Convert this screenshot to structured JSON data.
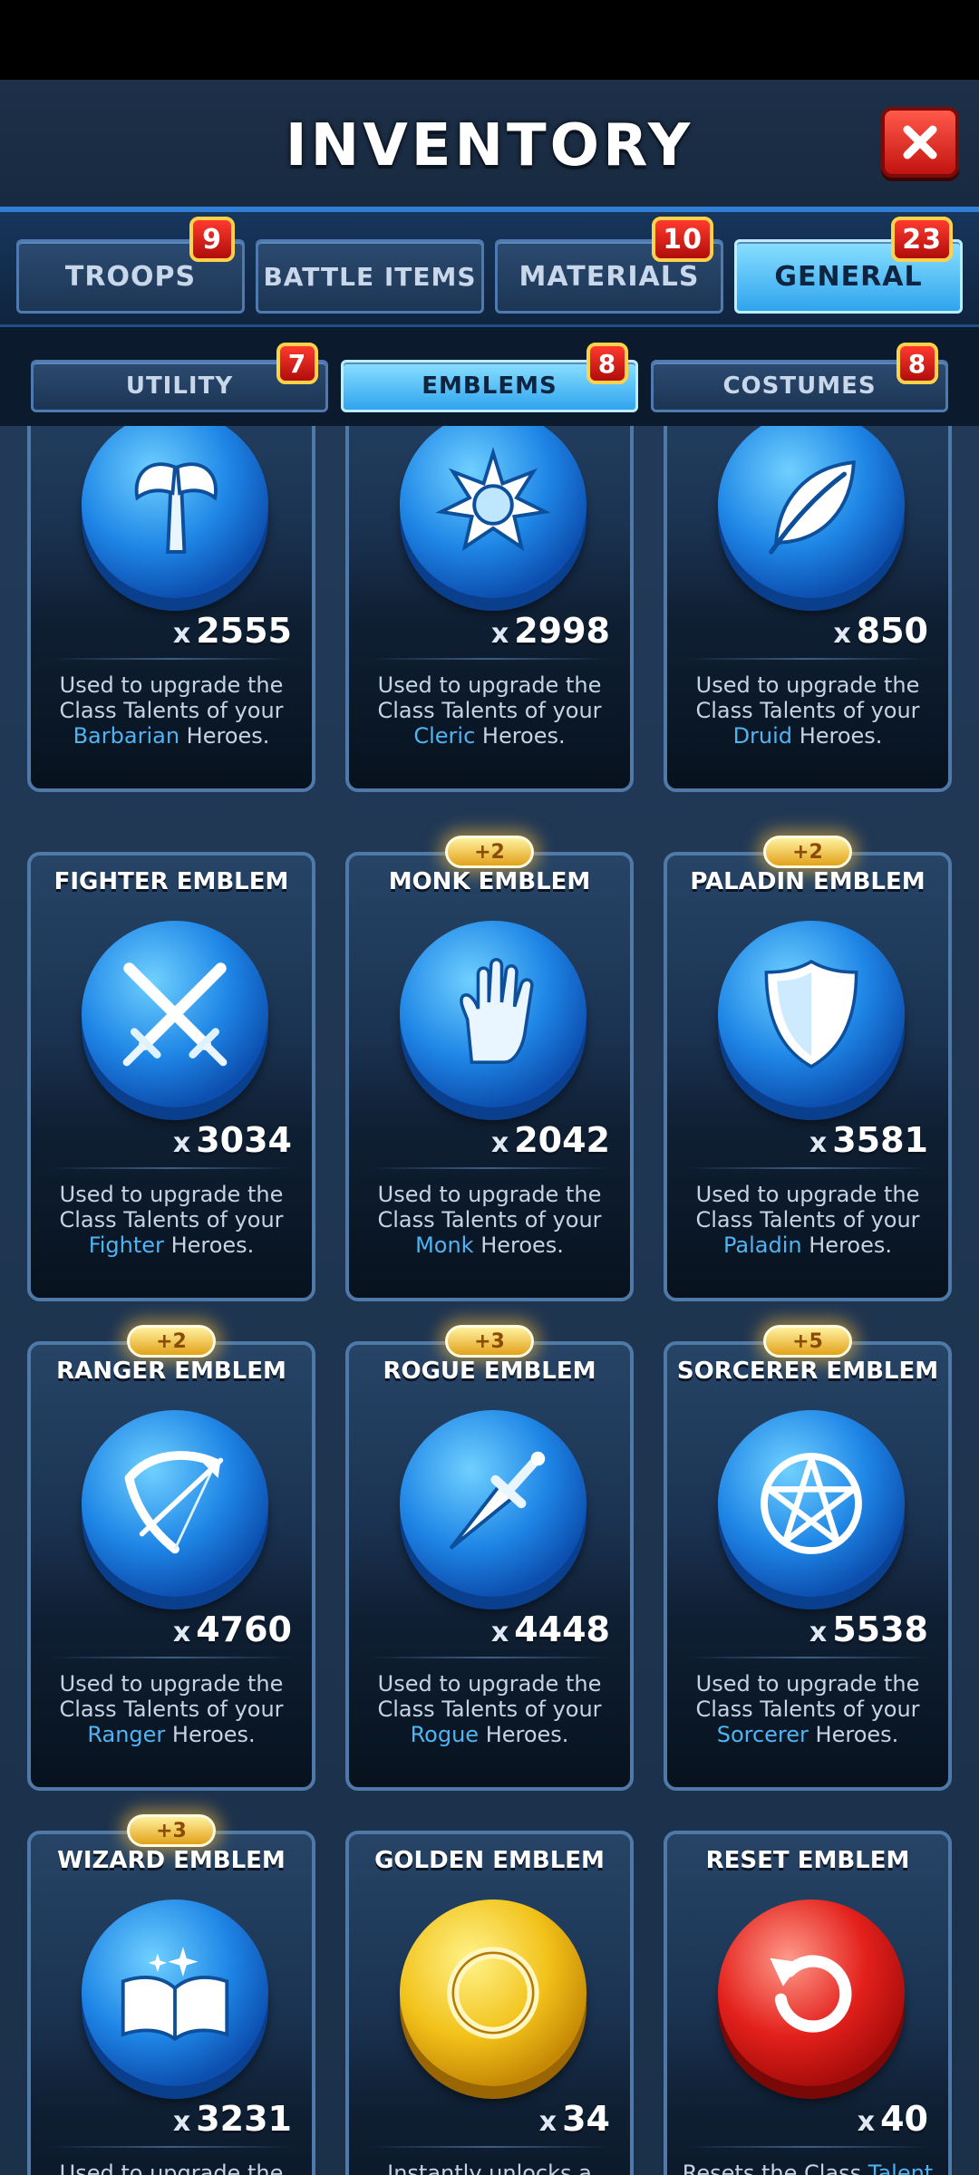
{
  "header": {
    "title": "INVENTORY",
    "close_icon": "close-icon"
  },
  "main_tabs": [
    {
      "label": "TROOPS",
      "badge": "9",
      "active": false
    },
    {
      "label": "BATTLE ITEMS",
      "badge": "",
      "active": false
    },
    {
      "label": "MATERIALS",
      "badge": "10",
      "active": false
    },
    {
      "label": "GENERAL",
      "badge": "23",
      "active": true
    }
  ],
  "sub_tabs": [
    {
      "label": "UTILITY",
      "badge": "7",
      "active": false
    },
    {
      "label": "EMBLEMS",
      "badge": "8",
      "active": true
    },
    {
      "label": "COSTUMES",
      "badge": "8",
      "active": false
    }
  ],
  "cards": [
    {
      "name": "",
      "bonus": "",
      "icon": "axe-icon",
      "coin": "blue",
      "count_prefix": "x",
      "count": "2555",
      "desc_a": "Used to upgrade the Class Talents of your",
      "desc_hl": "Barbarian",
      "desc_b": "Heroes."
    },
    {
      "name": "",
      "bonus": "",
      "icon": "sun-icon",
      "coin": "blue",
      "count_prefix": "x",
      "count": "2998",
      "desc_a": "Used to upgrade the Class Talents of your",
      "desc_hl": "Cleric",
      "desc_b": "Heroes."
    },
    {
      "name": "",
      "bonus": "",
      "icon": "leaf-icon",
      "coin": "blue",
      "count_prefix": "x",
      "count": "850",
      "desc_a": "Used to upgrade the Class Talents of your",
      "desc_hl": "Druid",
      "desc_b": "Heroes."
    },
    {
      "name": "FIGHTER EMBLEM",
      "bonus": "",
      "icon": "crossed-swords-icon",
      "coin": "blue",
      "count_prefix": "x",
      "count": "3034",
      "desc_a": "Used to upgrade the Class Talents of your",
      "desc_hl": "Fighter",
      "desc_b": "Heroes."
    },
    {
      "name": "MONK EMBLEM",
      "bonus": "+2",
      "icon": "hand-icon",
      "coin": "blue",
      "count_prefix": "x",
      "count": "2042",
      "desc_a": "Used to upgrade the Class Talents of your",
      "desc_hl": "Monk",
      "desc_b": "Heroes."
    },
    {
      "name": "PALADIN EMBLEM",
      "bonus": "+2",
      "icon": "shield-icon",
      "coin": "blue",
      "count_prefix": "x",
      "count": "3581",
      "desc_a": "Used to upgrade the Class Talents of your",
      "desc_hl": "Paladin",
      "desc_b": "Heroes."
    },
    {
      "name": "RANGER EMBLEM",
      "bonus": "+2",
      "icon": "bow-icon",
      "coin": "blue",
      "count_prefix": "x",
      "count": "4760",
      "desc_a": "Used to upgrade the Class Talents of your",
      "desc_hl": "Ranger",
      "desc_b": "Heroes."
    },
    {
      "name": "ROGUE EMBLEM",
      "bonus": "+3",
      "icon": "dagger-icon",
      "coin": "blue",
      "count_prefix": "x",
      "count": "4448",
      "desc_a": "Used to upgrade the Class Talents of your",
      "desc_hl": "Rogue",
      "desc_b": "Heroes."
    },
    {
      "name": "SORCERER EMBLEM",
      "bonus": "+5",
      "icon": "pentagram-icon",
      "coin": "blue",
      "count_prefix": "x",
      "count": "5538",
      "desc_a": "Used to upgrade the Class Talents of your",
      "desc_hl": "Sorcerer",
      "desc_b": "Heroes."
    },
    {
      "name": "WIZARD EMBLEM",
      "bonus": "+3",
      "icon": "spellbook-icon",
      "coin": "blue",
      "count_prefix": "x",
      "count": "3231",
      "desc_a": "Used to upgrade the",
      "desc_hl": "",
      "desc_b": ""
    },
    {
      "name": "GOLDEN EMBLEM",
      "bonus": "",
      "icon": "gold-ring-icon",
      "coin": "gold",
      "count_prefix": "x",
      "count": "34",
      "desc_a": "Instantly unlocks a",
      "desc_hl": "",
      "desc_b": ""
    },
    {
      "name": "RESET EMBLEM",
      "bonus": "",
      "icon": "reset-arrow-icon",
      "coin": "red",
      "count_prefix": "x",
      "count": "40",
      "desc_a": "Resets the Class",
      "desc_hl": "Talent",
      "desc_b": ""
    }
  ],
  "colors": {
    "accent": "#2fa4ee",
    "badge": "#d81a14",
    "highlight": "#4fb4f4",
    "bonus": "#f2b82a"
  }
}
